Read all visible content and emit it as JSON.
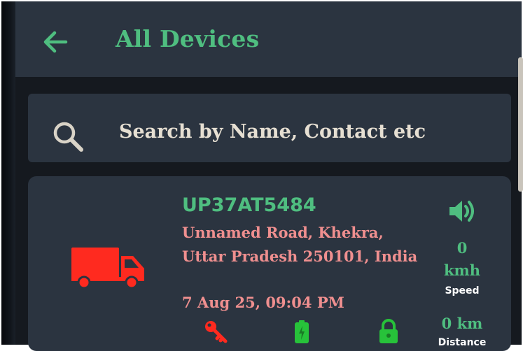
{
  "header": {
    "title": "All Devices"
  },
  "search": {
    "placeholder": "Search by Name, Contact etc"
  },
  "device": {
    "name": "UP37AT5484",
    "address_line_1": "Unnamed Road, Khekra,",
    "address_line_2": "Uttar Pradesh 250101, India",
    "timestamp": "7 Aug 25, 09:04 PM",
    "speed_value": "0",
    "speed_unit": "kmh",
    "speed_label": "Speed",
    "distance_value": "0 km",
    "distance_label": "Distance",
    "status_color": "#ff2a1f"
  },
  "icons": {
    "back": "arrow-left-icon",
    "search": "search-icon",
    "vehicle": "truck-icon",
    "sound": "volume-icon",
    "ignition": "key-icon",
    "battery": "battery-icon",
    "lock": "lock-icon"
  },
  "colors": {
    "accent": "#4fbe80",
    "address_text": "#ef8f8f",
    "surface": "#2b3440",
    "background": "#15191f"
  }
}
